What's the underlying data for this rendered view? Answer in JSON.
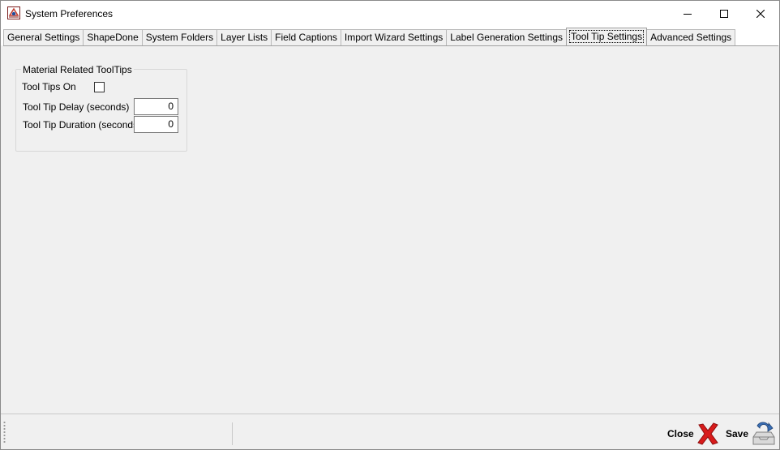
{
  "window": {
    "title": "System Preferences",
    "app_icon": "app-icon",
    "controls": [
      "minimize-icon",
      "maximize-icon",
      "close-icon"
    ]
  },
  "tabs": [
    {
      "label": "General Settings",
      "active": false
    },
    {
      "label": "ShapeDone",
      "active": false
    },
    {
      "label": "System Folders",
      "active": false
    },
    {
      "label": "Layer Lists",
      "active": false
    },
    {
      "label": "Field Captions",
      "active": false
    },
    {
      "label": "Import Wizard Settings",
      "active": false
    },
    {
      "label": "Label Generation Settings",
      "active": false
    },
    {
      "label": "Tool Tip Settings",
      "active": true
    },
    {
      "label": "Advanced Settings",
      "active": false
    }
  ],
  "tooltips_group": {
    "legend": "Material Related ToolTips",
    "tooltips_on_label": "Tool Tips On",
    "tooltips_on_checked": false,
    "delay_label": "Tool Tip Delay (seconds)",
    "delay_value": "0",
    "duration_label": "Tool Tip Duration (seconds)",
    "duration_value": "0"
  },
  "bottom": {
    "close_label": "Close",
    "close_icon": "red-x-icon",
    "save_label": "Save",
    "save_icon": "save-tray-icon"
  },
  "colors": {
    "close_icon": "#d81b1b",
    "save_icon": "#3a6fb5",
    "background": "#f0f0f0"
  }
}
